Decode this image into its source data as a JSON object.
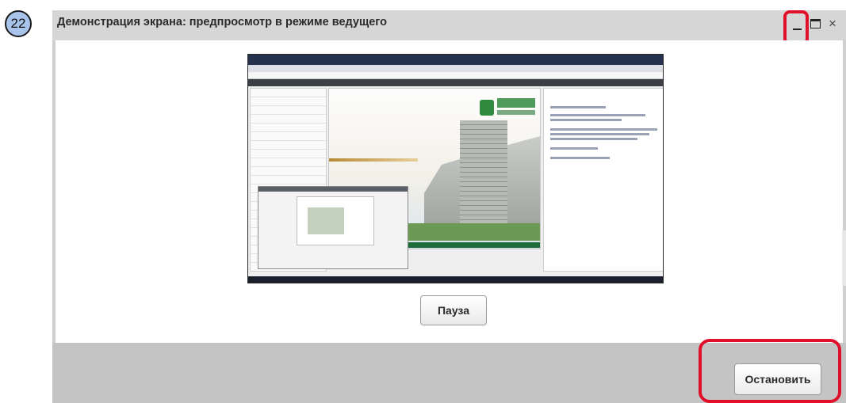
{
  "step_badge": "22",
  "window": {
    "title": "Демонстрация экрана: предпросмотр в режиме ведущего",
    "controls": {
      "minimize_icon": "–",
      "maximize_icon": "□",
      "close_icon": "×"
    }
  },
  "preview": {
    "slide_logo_text": "БГТУ"
  },
  "buttons": {
    "pause_label": "Пауза",
    "stop_label": "Остановить"
  },
  "colors": {
    "highlight": "#e0102a",
    "titlebar": "#d6d6d6",
    "footer": "#c4c4c4"
  }
}
